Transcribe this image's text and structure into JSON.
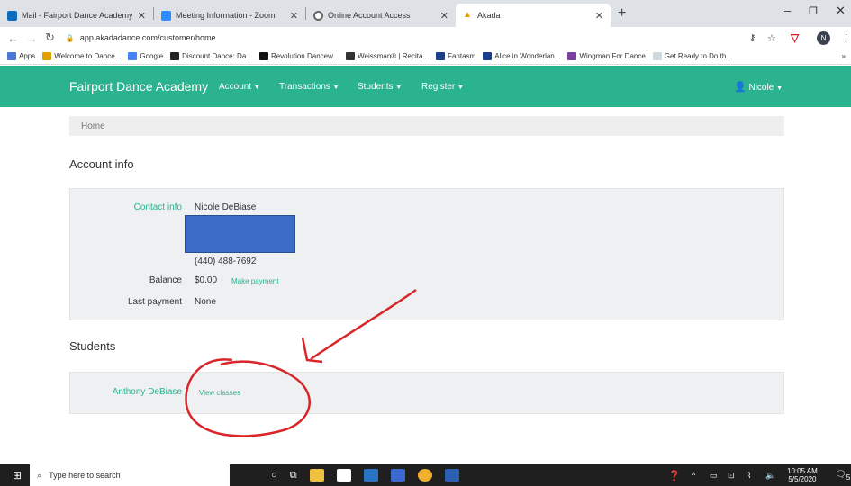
{
  "browser": {
    "tabs": [
      {
        "title": "Mail - Fairport Dance Academy -",
        "color": "#0f6cbd"
      },
      {
        "title": "Meeting Information - Zoom",
        "color": "#2d8cff"
      },
      {
        "title": "Online Account Access",
        "color": "#666666"
      },
      {
        "title": "Akada",
        "color": "#e0a100",
        "active": true
      }
    ],
    "url": "app.akadadance.com/customer/home",
    "profile_initial": "N",
    "bookmarks": [
      "Apps",
      "Welcome to Dance...",
      "Google",
      "Discount Dance: Da...",
      "Revolution Dancew...",
      "Weissman® | Recita...",
      "Fantasm",
      "Alice in Wonderlan...",
      "Wingman For Dance",
      "Get Ready to Do th..."
    ]
  },
  "navbar": {
    "brand": "Fairport Dance Academy",
    "menus": [
      "Account",
      "Transactions",
      "Students",
      "Register"
    ],
    "user": "Nicole",
    "color": "#2bb38f"
  },
  "breadcrumb": "Home",
  "account": {
    "heading": "Account info",
    "contact_label": "Contact info",
    "contact_name": "Nicole DeBiase",
    "phone": "(440) 488-7692",
    "balance_label": "Balance",
    "balance": "$0.00",
    "make_payment": "Make payment",
    "last_payment_label": "Last payment",
    "last_payment": "None"
  },
  "students": {
    "heading": "Students",
    "items": [
      {
        "name": "Anthony DeBiase",
        "action": "View classes"
      }
    ]
  },
  "taskbar": {
    "search_placeholder": "Type here to search",
    "time": "10:05 AM",
    "date": "5/5/2020",
    "notifications": "5"
  }
}
